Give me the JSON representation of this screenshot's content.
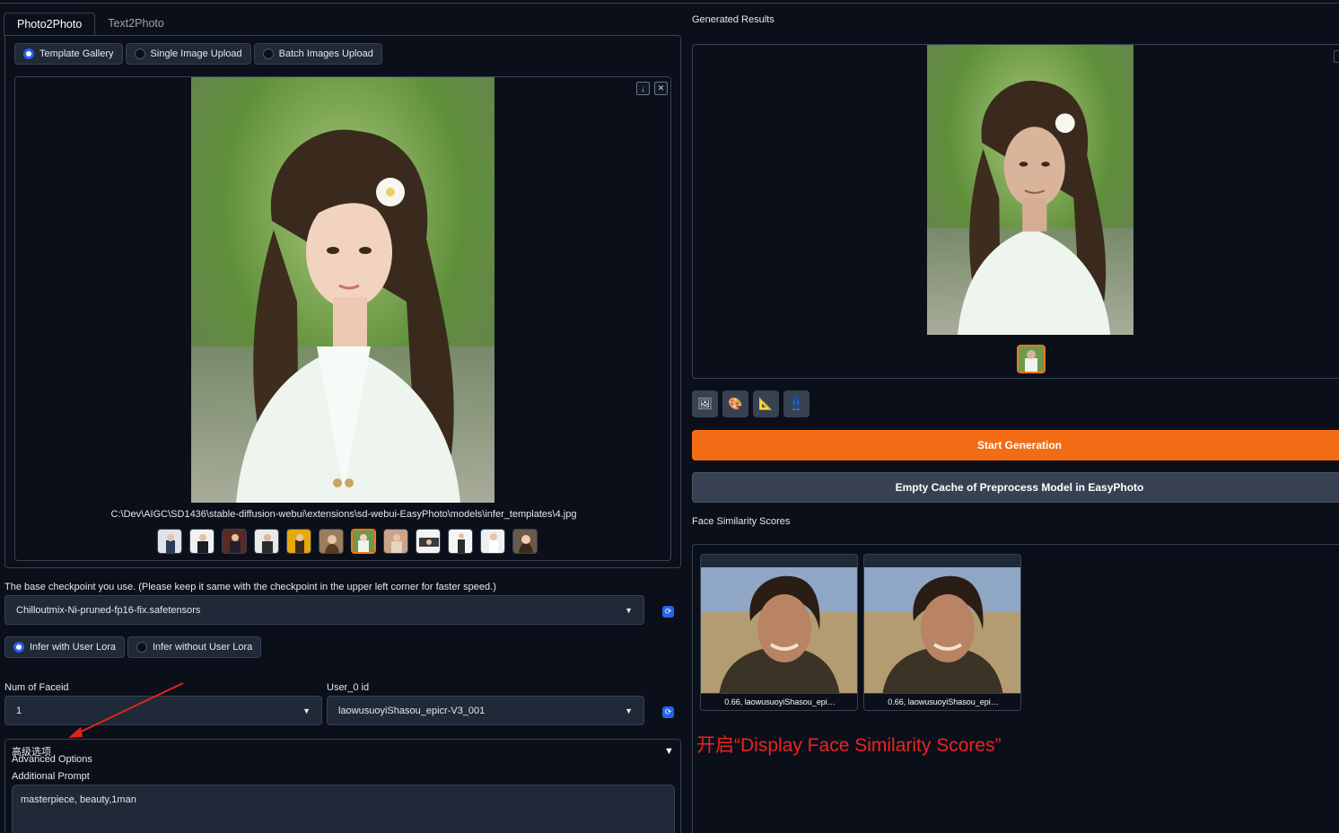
{
  "tabs": [
    "Photo2Photo",
    "Text2Photo"
  ],
  "input_mode": {
    "options": [
      "Template Gallery",
      "Single Image Upload",
      "Batch Images Upload"
    ],
    "selected": "Template Gallery"
  },
  "gallery": {
    "image_icon": "portrait-woman-white-cardigan-image",
    "download_icon": "download-icon",
    "close_icon": "close-icon",
    "caption": "C:\\Dev\\AIGC\\SD1436\\stable-diffusion-webui\\extensions\\sd-webui-EasyPhoto\\models\\infer_templates\\4.jpg",
    "thumbnail_count": 12,
    "selected_index": 6
  },
  "checkpoint": {
    "label": "The base checkpoint you use. (Please keep it same with the checkpoint in the upper left corner for faster speed.)",
    "value": "Chilloutmix-Ni-pruned-fp16-fix.safetensors"
  },
  "lora_mode": {
    "options": [
      "Infer with User Lora",
      "Infer without User Lora"
    ],
    "selected": "Infer with User Lora"
  },
  "faceid": {
    "label": "Num of Faceid",
    "value": "1"
  },
  "user_id": {
    "label": "User_0 id",
    "value": "laowusuoyiShasou_epicr-V3_001"
  },
  "advanced": {
    "title_cn": "高级选项",
    "title_en": "Advanced Options",
    "prompt_label": "Additional Prompt",
    "prompt_value": "masterpiece, beauty,1man"
  },
  "results": {
    "label": "Generated Results",
    "image_icon": "generated-portrait-image",
    "tool_icons": [
      "image-icon",
      "palette-icon",
      "ruler-icon",
      "save-icon"
    ]
  },
  "buttons": {
    "start": "Start Generation",
    "empty_cache": "Empty Cache of Preprocess Model in EasyPhoto"
  },
  "similarity": {
    "label": "Face Similarity Scores",
    "cards": [
      {
        "caption": "0.66, laowusuoyiShasou_epi…"
      },
      {
        "caption": "0.66, laowusuoyiShasou_epi…"
      }
    ]
  },
  "annotation": {
    "text": "开启“Display Face Similarity Scores”",
    "color": "#ef2222"
  },
  "colors": {
    "background": "#0b0f19",
    "accent_orange": "#f26b15",
    "accent_blue": "#2563eb"
  }
}
